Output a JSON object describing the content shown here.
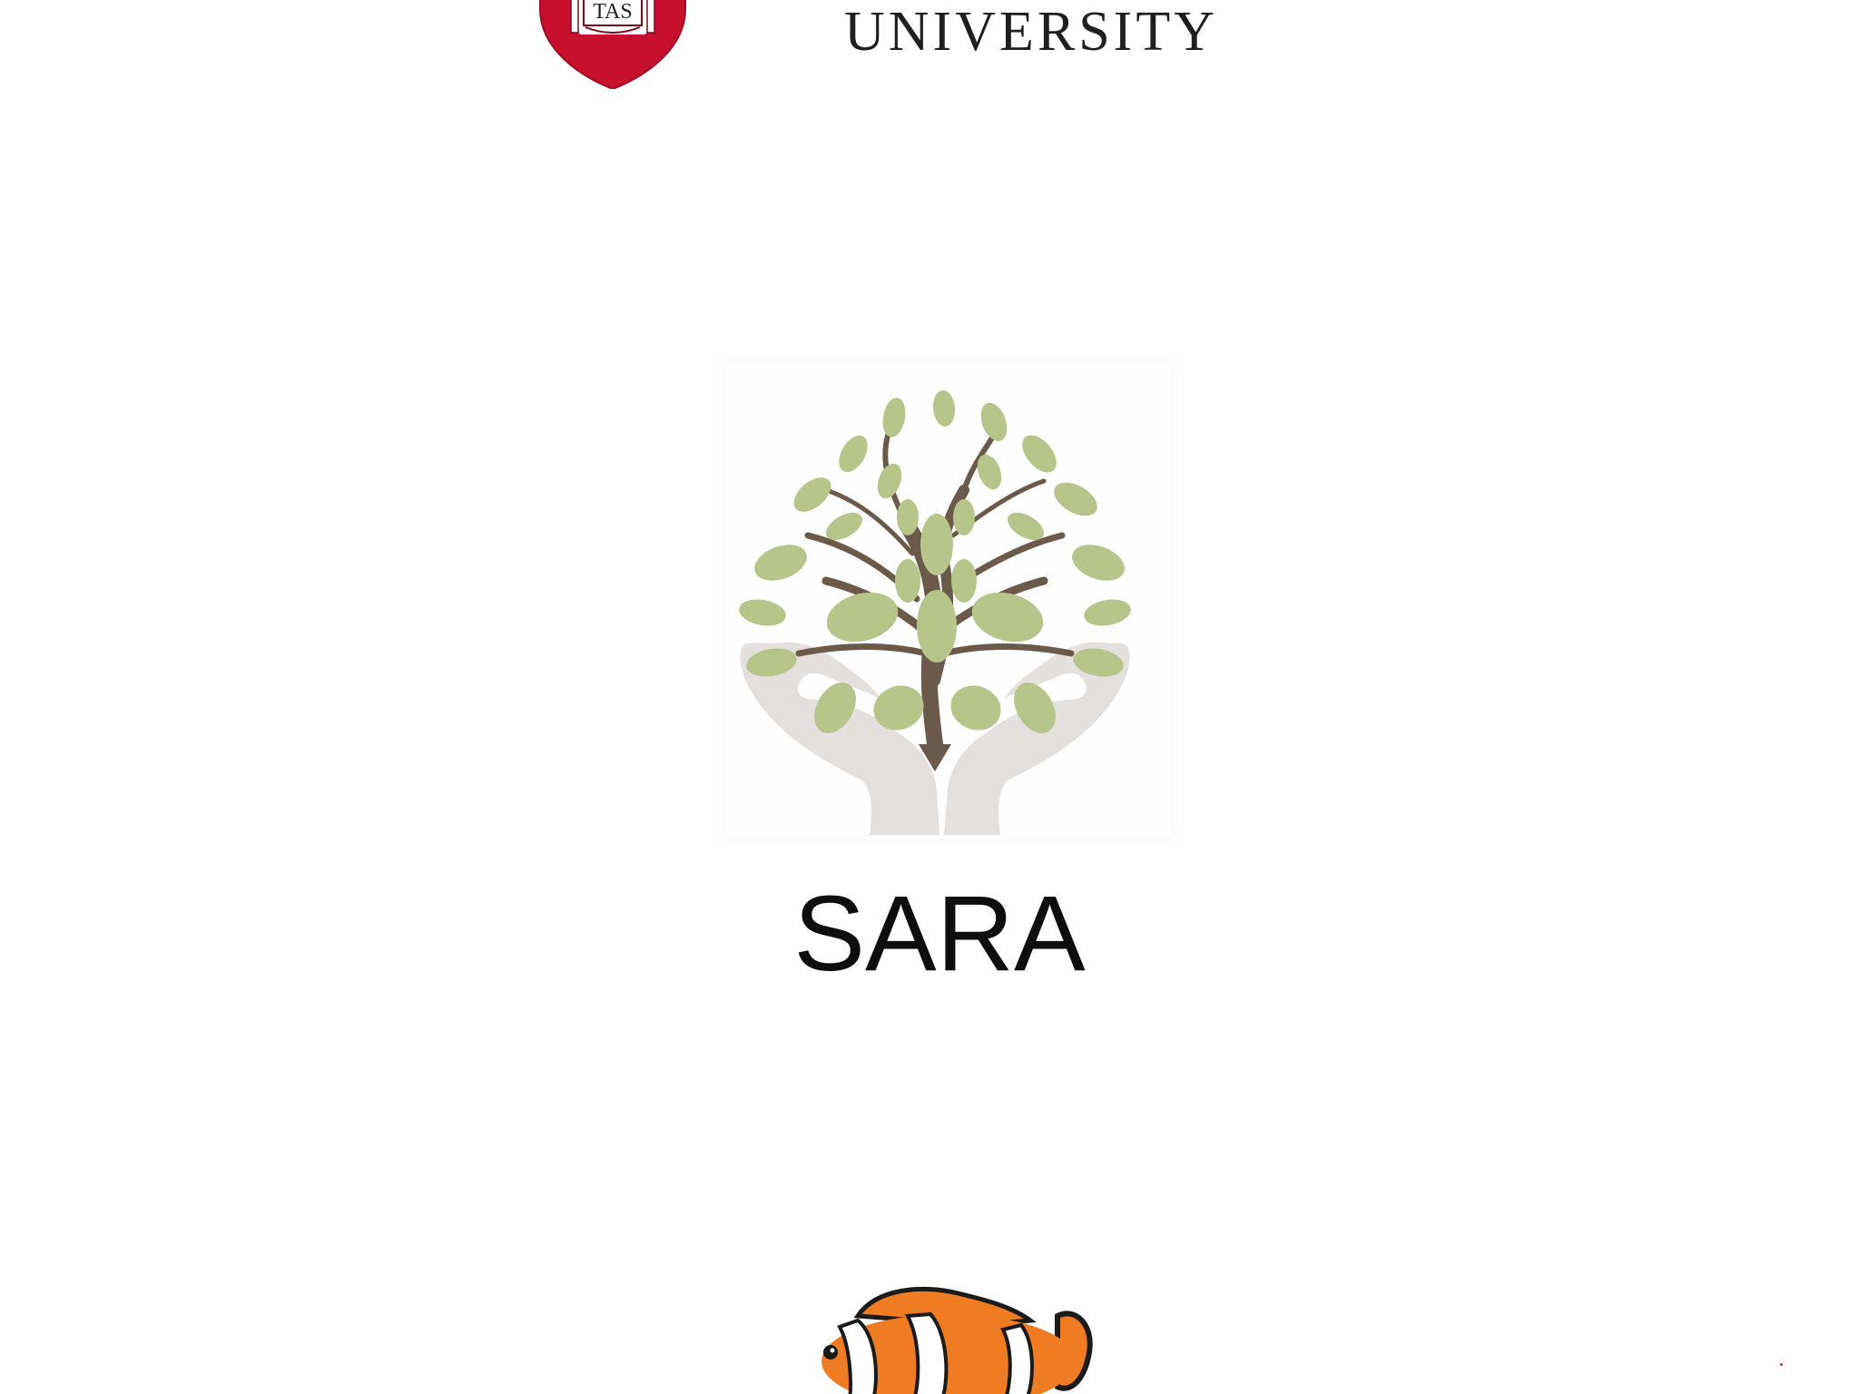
{
  "screen": "splash",
  "header": {
    "logo_icon": "university-shield-icon",
    "shield_text": "TAS",
    "wordmark": "UNIVERSITY",
    "brand_color": "#c8102e"
  },
  "app": {
    "logo_icon": "tree-in-hands-icon",
    "name": "SARA",
    "leaf_color": "#b7c48a",
    "trunk_color": "#6b5a4a",
    "hands_color": "#e3e0de"
  },
  "mascot": {
    "icon": "clownfish-icon",
    "body_color": "#ef7b22"
  }
}
